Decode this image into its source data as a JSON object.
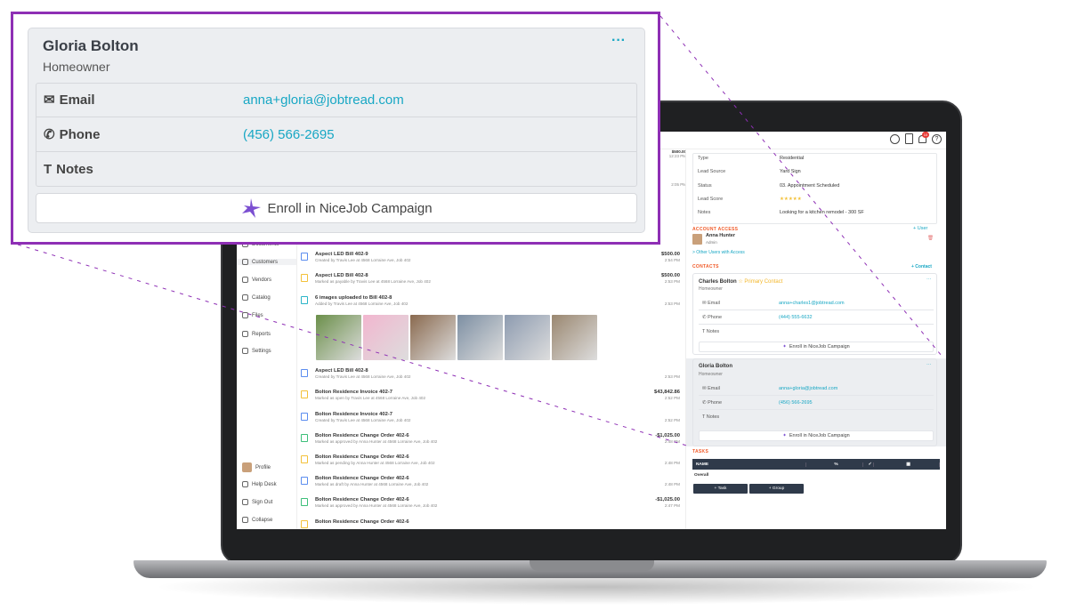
{
  "topbar": {
    "icons": [
      "clock-icon",
      "clipboard-icon",
      "bell-icon",
      "help-icon"
    ],
    "notification_count": "10"
  },
  "sidebar": {
    "items": [
      {
        "label": "Documents"
      },
      {
        "label": "Customers"
      },
      {
        "label": "Vendors"
      },
      {
        "label": "Catalog"
      },
      {
        "label": "Files"
      },
      {
        "label": "Reports"
      },
      {
        "label": "Settings"
      }
    ],
    "bottom": [
      {
        "label": "Profile"
      },
      {
        "label": "Help Desk"
      },
      {
        "label": "Sign Out"
      },
      {
        "label": "Collapse"
      }
    ]
  },
  "feed": {
    "partial": [
      {
        "amount": "$500.00",
        "time": "12:23 PM"
      },
      {
        "time": "2:05 PM"
      }
    ],
    "items": [
      {
        "title": "Aspect LED Bill 402-9",
        "sub": "Created by Travis Lee at 4568 Lorraine Ave, Job 402",
        "amount": "$500.00",
        "time": "2:54 PM",
        "color": "#5b8def"
      },
      {
        "title": "Aspect LED Bill 402-8",
        "sub": "Marked as payable by Travis Lee at 4568 Lorraine Ave, Job 402",
        "amount": "$500.00",
        "time": "2:53 PM",
        "color": "#f3c13a"
      },
      {
        "title": "6 images uploaded to Bill 402-8",
        "sub": "Added by Travis Lee at 4568 Lorraine Ave, Job 402",
        "amount": "",
        "time": "2:53 PM",
        "color": "#2bb5c8"
      },
      {
        "title": "Aspect LED Bill 402-8",
        "sub": "Created by Travis Lee at 4568 Lorraine Ave, Job 402",
        "amount": "",
        "time": "2:53 PM",
        "color": "#5b8def"
      },
      {
        "title": "Bolton Residence Invoice 402-7",
        "sub": "Marked as open by Travis Lee at 4568 Lorraine Ave, Job 402",
        "amount": "$43,842.86",
        "time": "2:52 PM",
        "color": "#f3c13a"
      },
      {
        "title": "Bolton Residence Invoice 402-7",
        "sub": "Created by Travis Lee at 4568 Lorraine Ave, Job 402",
        "amount": "",
        "time": "2:52 PM",
        "color": "#5b8def"
      },
      {
        "title": "Bolton Residence Change Order 402-6",
        "sub": "Marked as approved by Anna Hunter at 4568 Lorraine Ave, Job 402",
        "amount": "-$1,025.00",
        "time": "2:48 PM",
        "color": "#3dbf7a"
      },
      {
        "title": "Bolton Residence Change Order 402-6",
        "sub": "Marked as pending by Anna Hunter at 4568 Lorraine Ave, Job 402",
        "amount": "",
        "time": "2:48 PM",
        "color": "#f3c13a"
      },
      {
        "title": "Bolton Residence Change Order 402-6",
        "sub": "Marked as draft by Anna Hunter at 4568 Lorraine Ave, Job 402",
        "amount": "",
        "time": "2:48 PM",
        "color": "#5b8def"
      },
      {
        "title": "Bolton Residence Change Order 402-6",
        "sub": "Marked as approved by Anna Hunter at 4568 Lorraine Ave, Job 402",
        "amount": "-$1,025.00",
        "time": "2:47 PM",
        "color": "#3dbf7a"
      },
      {
        "title": "Bolton Residence Change Order 402-6",
        "sub": "",
        "amount": "",
        "time": "",
        "color": "#f3c13a"
      }
    ],
    "thumbs": [
      "#6b8f4a",
      "#f2b6cf",
      "#8a6a4f",
      "#7d8fa3",
      "#8d9bb0",
      "#9a8770"
    ]
  },
  "details": [
    {
      "label": "Type",
      "value": "Residential"
    },
    {
      "label": "Lead Source",
      "value": "Yard Sign"
    },
    {
      "label": "Status",
      "value": "03. Appointment Scheduled"
    },
    {
      "label": "Lead Score",
      "value": "★★★★★"
    },
    {
      "label": "Notes",
      "value": "Looking for a kitchen remodel - 300 SF"
    }
  ],
  "account_access": {
    "heading": "ACCOUNT ACCESS",
    "add": "+ User",
    "user_name": "Anna Hunter",
    "user_role": "Admin",
    "other": "> Other Users with Access"
  },
  "contacts": {
    "heading": "CONTACTS",
    "add": "+ Contact",
    "list": [
      {
        "name": "Charles Bolton",
        "badge": "☆ Primary Contact",
        "role": "Homeowner",
        "email": "anna+charles1@jobtread.com",
        "phone": "(444) 555-6632"
      },
      {
        "name": "Gloria Bolton",
        "role": "Homeowner",
        "email": "anna+gloria@jobtread.com",
        "phone": "(456) 566-2695"
      }
    ],
    "labels": {
      "email": "Email",
      "phone": "Phone",
      "notes": "Notes",
      "enroll": "Enroll in NiceJob Campaign",
      "menu": "···"
    }
  },
  "tasks": {
    "heading": "TASKS",
    "columns": [
      "NAME",
      "%",
      "✓",
      "▦"
    ],
    "row": "Overall",
    "add_task": "+ Task",
    "add_group": "+ Group"
  },
  "callout": {
    "name": "Gloria Bolton",
    "role": "Homeowner",
    "email_label": "Email",
    "email": "anna+gloria@jobtread.com",
    "phone_label": "Phone",
    "phone": "(456) 566-2695",
    "notes_label": "Notes",
    "enroll": "Enroll in NiceJob Campaign",
    "menu": "···"
  },
  "colors": {
    "accent": "#18a7c4",
    "callout_border": "#8e2fb5",
    "section": "#f05a28",
    "task_header": "#2f3a4a"
  }
}
